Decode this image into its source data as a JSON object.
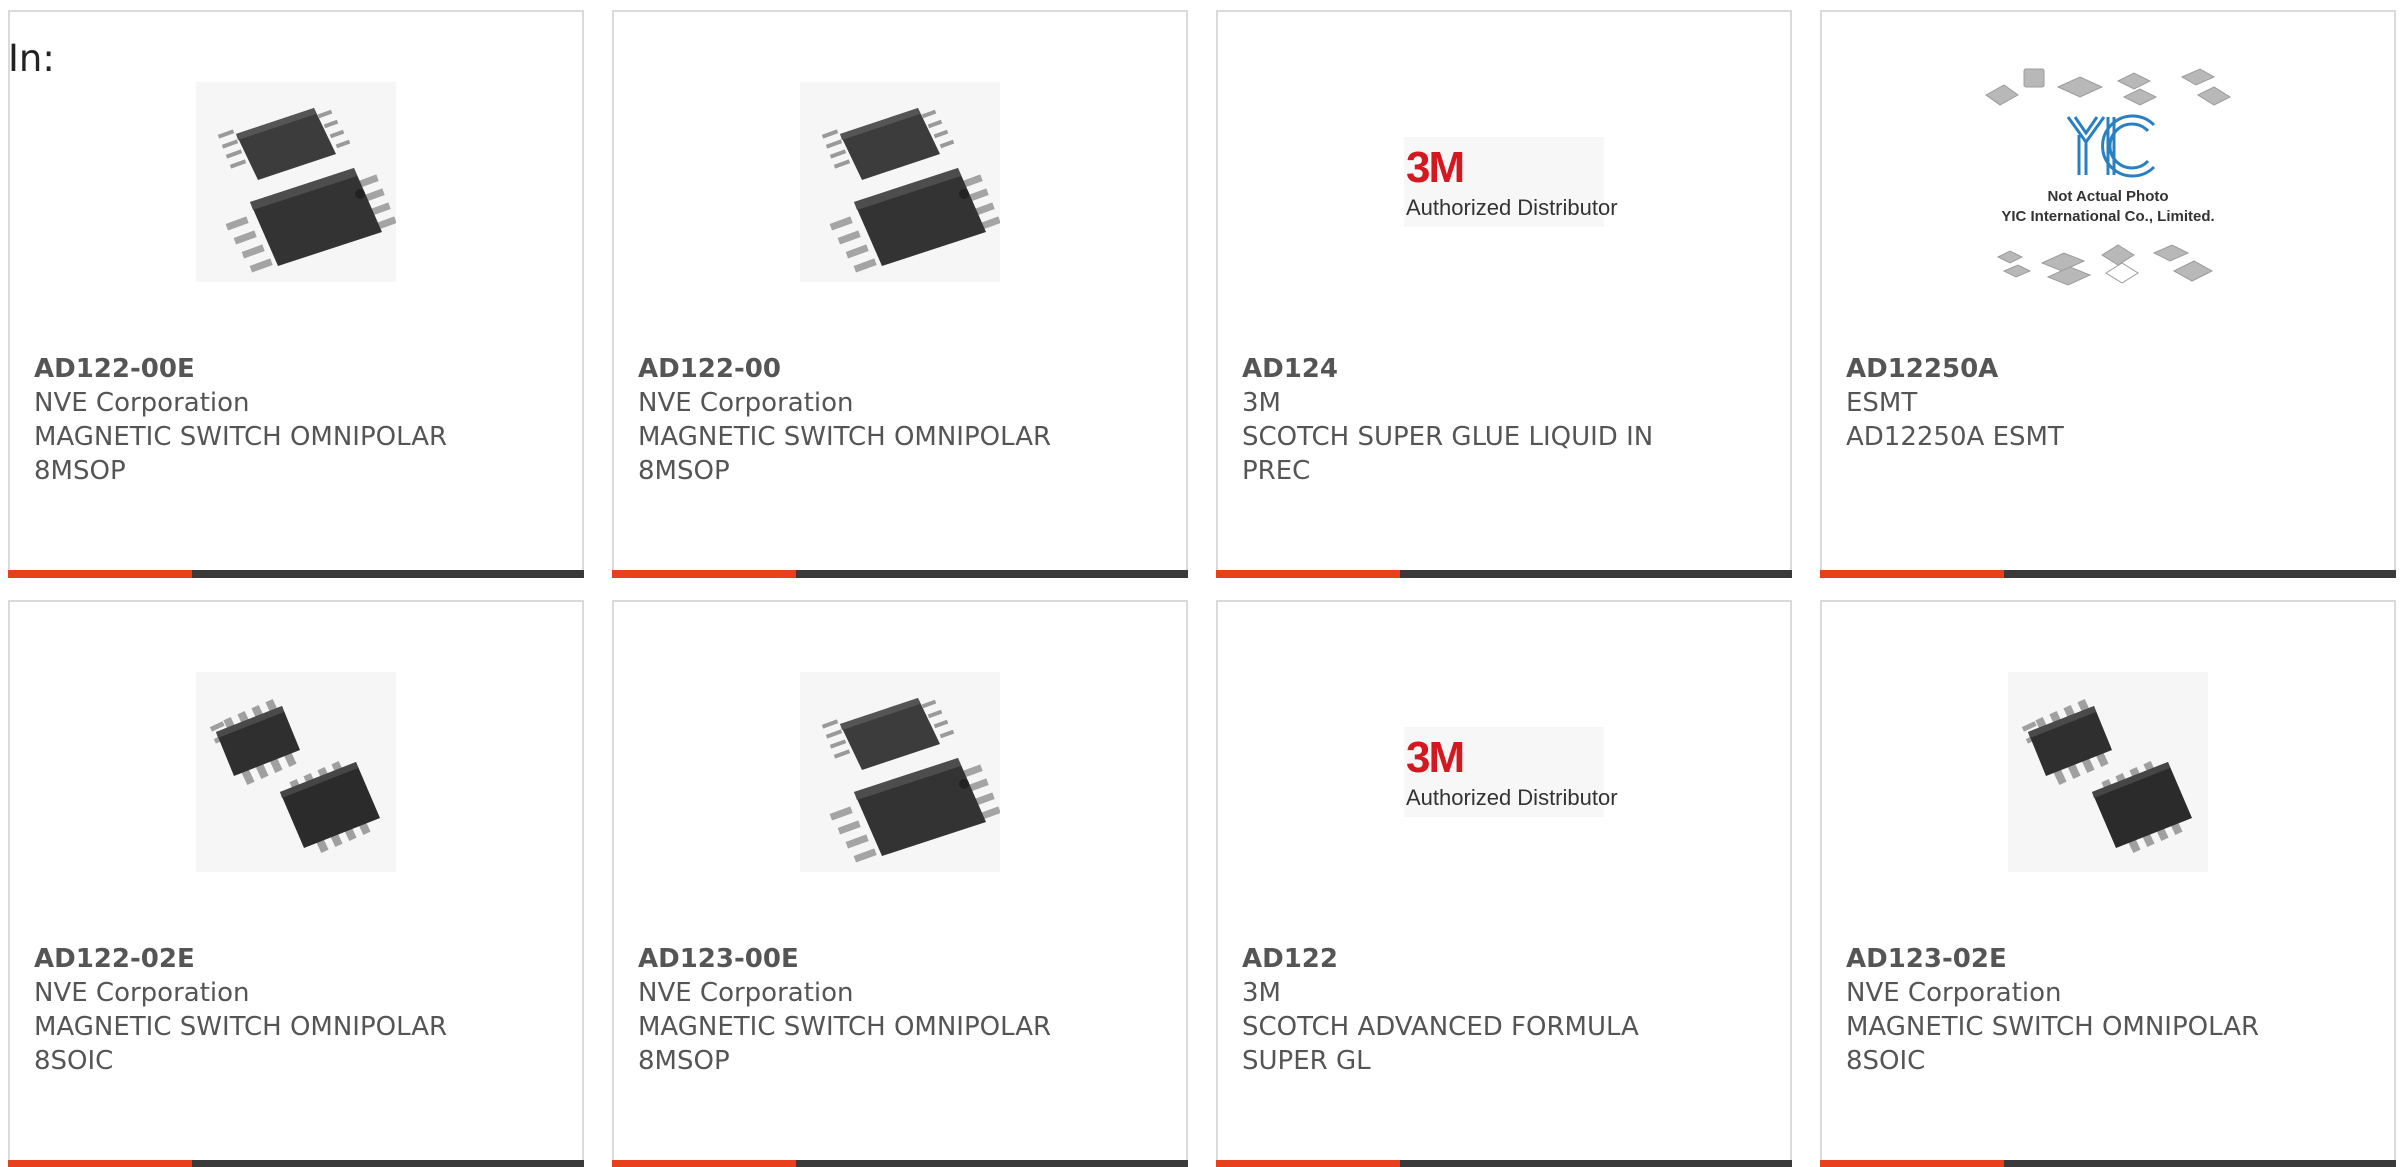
{
  "filter_label": "In:",
  "cards": [
    {
      "part_number": "AD122-00E",
      "manufacturer": "NVE Corporation",
      "description_line1": "MAGNETIC SWITCH OMNIPOLAR",
      "description_line2": "8MSOP",
      "image": "ic-msop-package"
    },
    {
      "part_number": "AD122-00",
      "manufacturer": "NVE Corporation",
      "description_line1": "MAGNETIC SWITCH OMNIPOLAR",
      "description_line2": "8MSOP",
      "image": "ic-msop-package"
    },
    {
      "part_number": "AD124",
      "manufacturer": "3M",
      "description_line1": "SCOTCH SUPER GLUE LIQUID IN",
      "description_line2": "PREC",
      "image": "brand-logo",
      "logo_mark": "3M",
      "logo_sub": "Authorized Distributor"
    },
    {
      "part_number": "AD12250A",
      "manufacturer": "ESMT",
      "description_line1": "AD12250A ESMT",
      "description_line2": "",
      "image": "placeholder-not-actual-photo",
      "placeholder_line1": "Not Actual Photo",
      "placeholder_line2": "YIC International Co., Limited."
    },
    {
      "part_number": "AD122-02E",
      "manufacturer": "NVE Corporation",
      "description_line1": "MAGNETIC SWITCH OMNIPOLAR",
      "description_line2": "8SOIC",
      "image": "ic-soic-package"
    },
    {
      "part_number": "AD123-00E",
      "manufacturer": "NVE Corporation",
      "description_line1": "MAGNETIC SWITCH OMNIPOLAR",
      "description_line2": "8MSOP",
      "image": "ic-msop-package"
    },
    {
      "part_number": "AD122",
      "manufacturer": "3M",
      "description_line1": "SCOTCH ADVANCED FORMULA",
      "description_line2": "SUPER GL",
      "image": "brand-logo",
      "logo_mark": "3M",
      "logo_sub": "Authorized Distributor"
    },
    {
      "part_number": "AD123-02E",
      "manufacturer": "NVE Corporation",
      "description_line1": "MAGNETIC SWITCH OMNIPOLAR",
      "description_line2": "8SOIC",
      "image": "ic-soic-package"
    }
  ],
  "colors": {
    "accent": "#e8401c",
    "bar_dark": "#3a3a3a",
    "border": "#dadada",
    "text": "#555555"
  }
}
